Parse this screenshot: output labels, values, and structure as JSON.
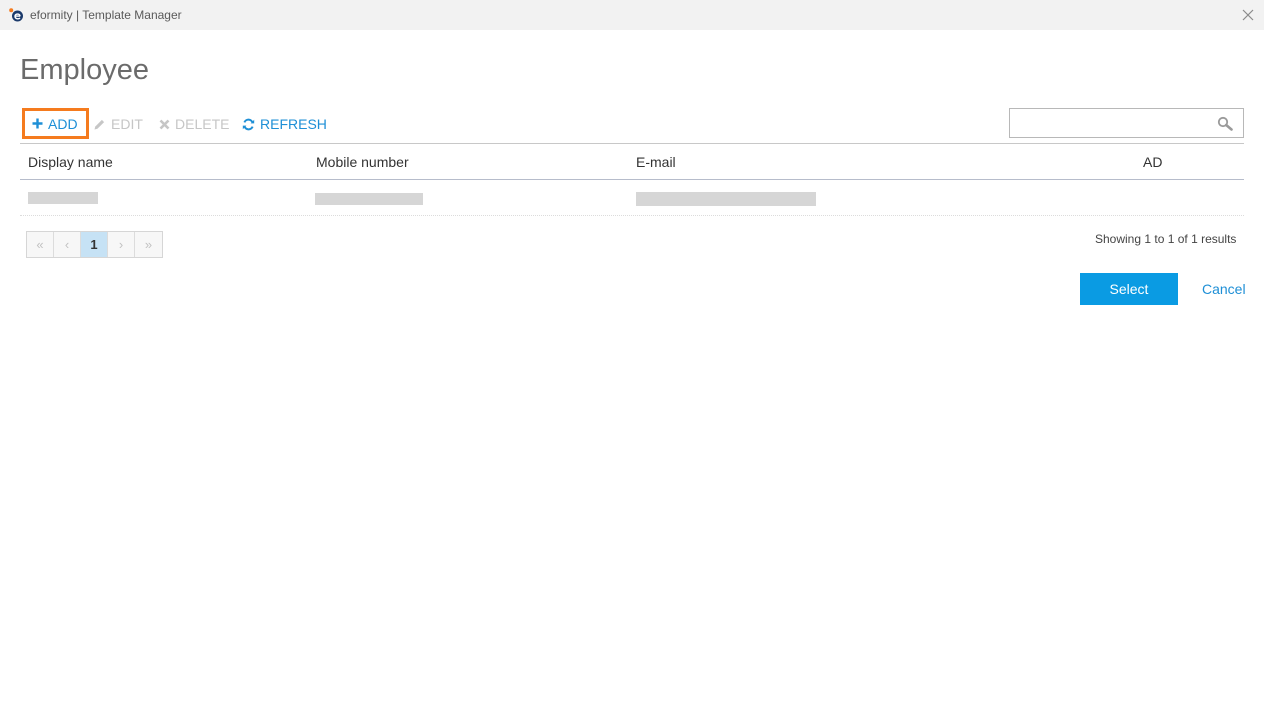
{
  "window": {
    "title": "eformity | Template Manager",
    "logo_icon": "eformity-logo-icon",
    "close_icon": "close-icon"
  },
  "page": {
    "title": "Employee"
  },
  "toolbar": {
    "add_label": "ADD",
    "edit_label": "EDIT",
    "delete_label": "DELETE",
    "refresh_label": "REFRESH",
    "add_icon": "plus-icon",
    "edit_icon": "pencil-icon",
    "delete_icon": "x-icon",
    "refresh_icon": "refresh-icon",
    "highlight_color": "#f57b1e",
    "accent_color": "#1e8fd6",
    "disabled_color": "#c6c6c6"
  },
  "search": {
    "value": "",
    "placeholder": "",
    "icon": "search-icon"
  },
  "table": {
    "columns": [
      "Display name",
      "Mobile number",
      "E-mail",
      "AD"
    ],
    "rows": [
      {
        "display_name": "",
        "mobile_number": "",
        "email": "",
        "ad": ""
      }
    ]
  },
  "pagination": {
    "first_label": "«",
    "prev_label": "‹",
    "current_page": "1",
    "next_label": "›",
    "last_label": "»"
  },
  "results": {
    "text": "Showing 1 to 1 of 1 results"
  },
  "footer": {
    "select_label": "Select",
    "cancel_label": "Cancel",
    "select_color": "#0a9be3"
  }
}
